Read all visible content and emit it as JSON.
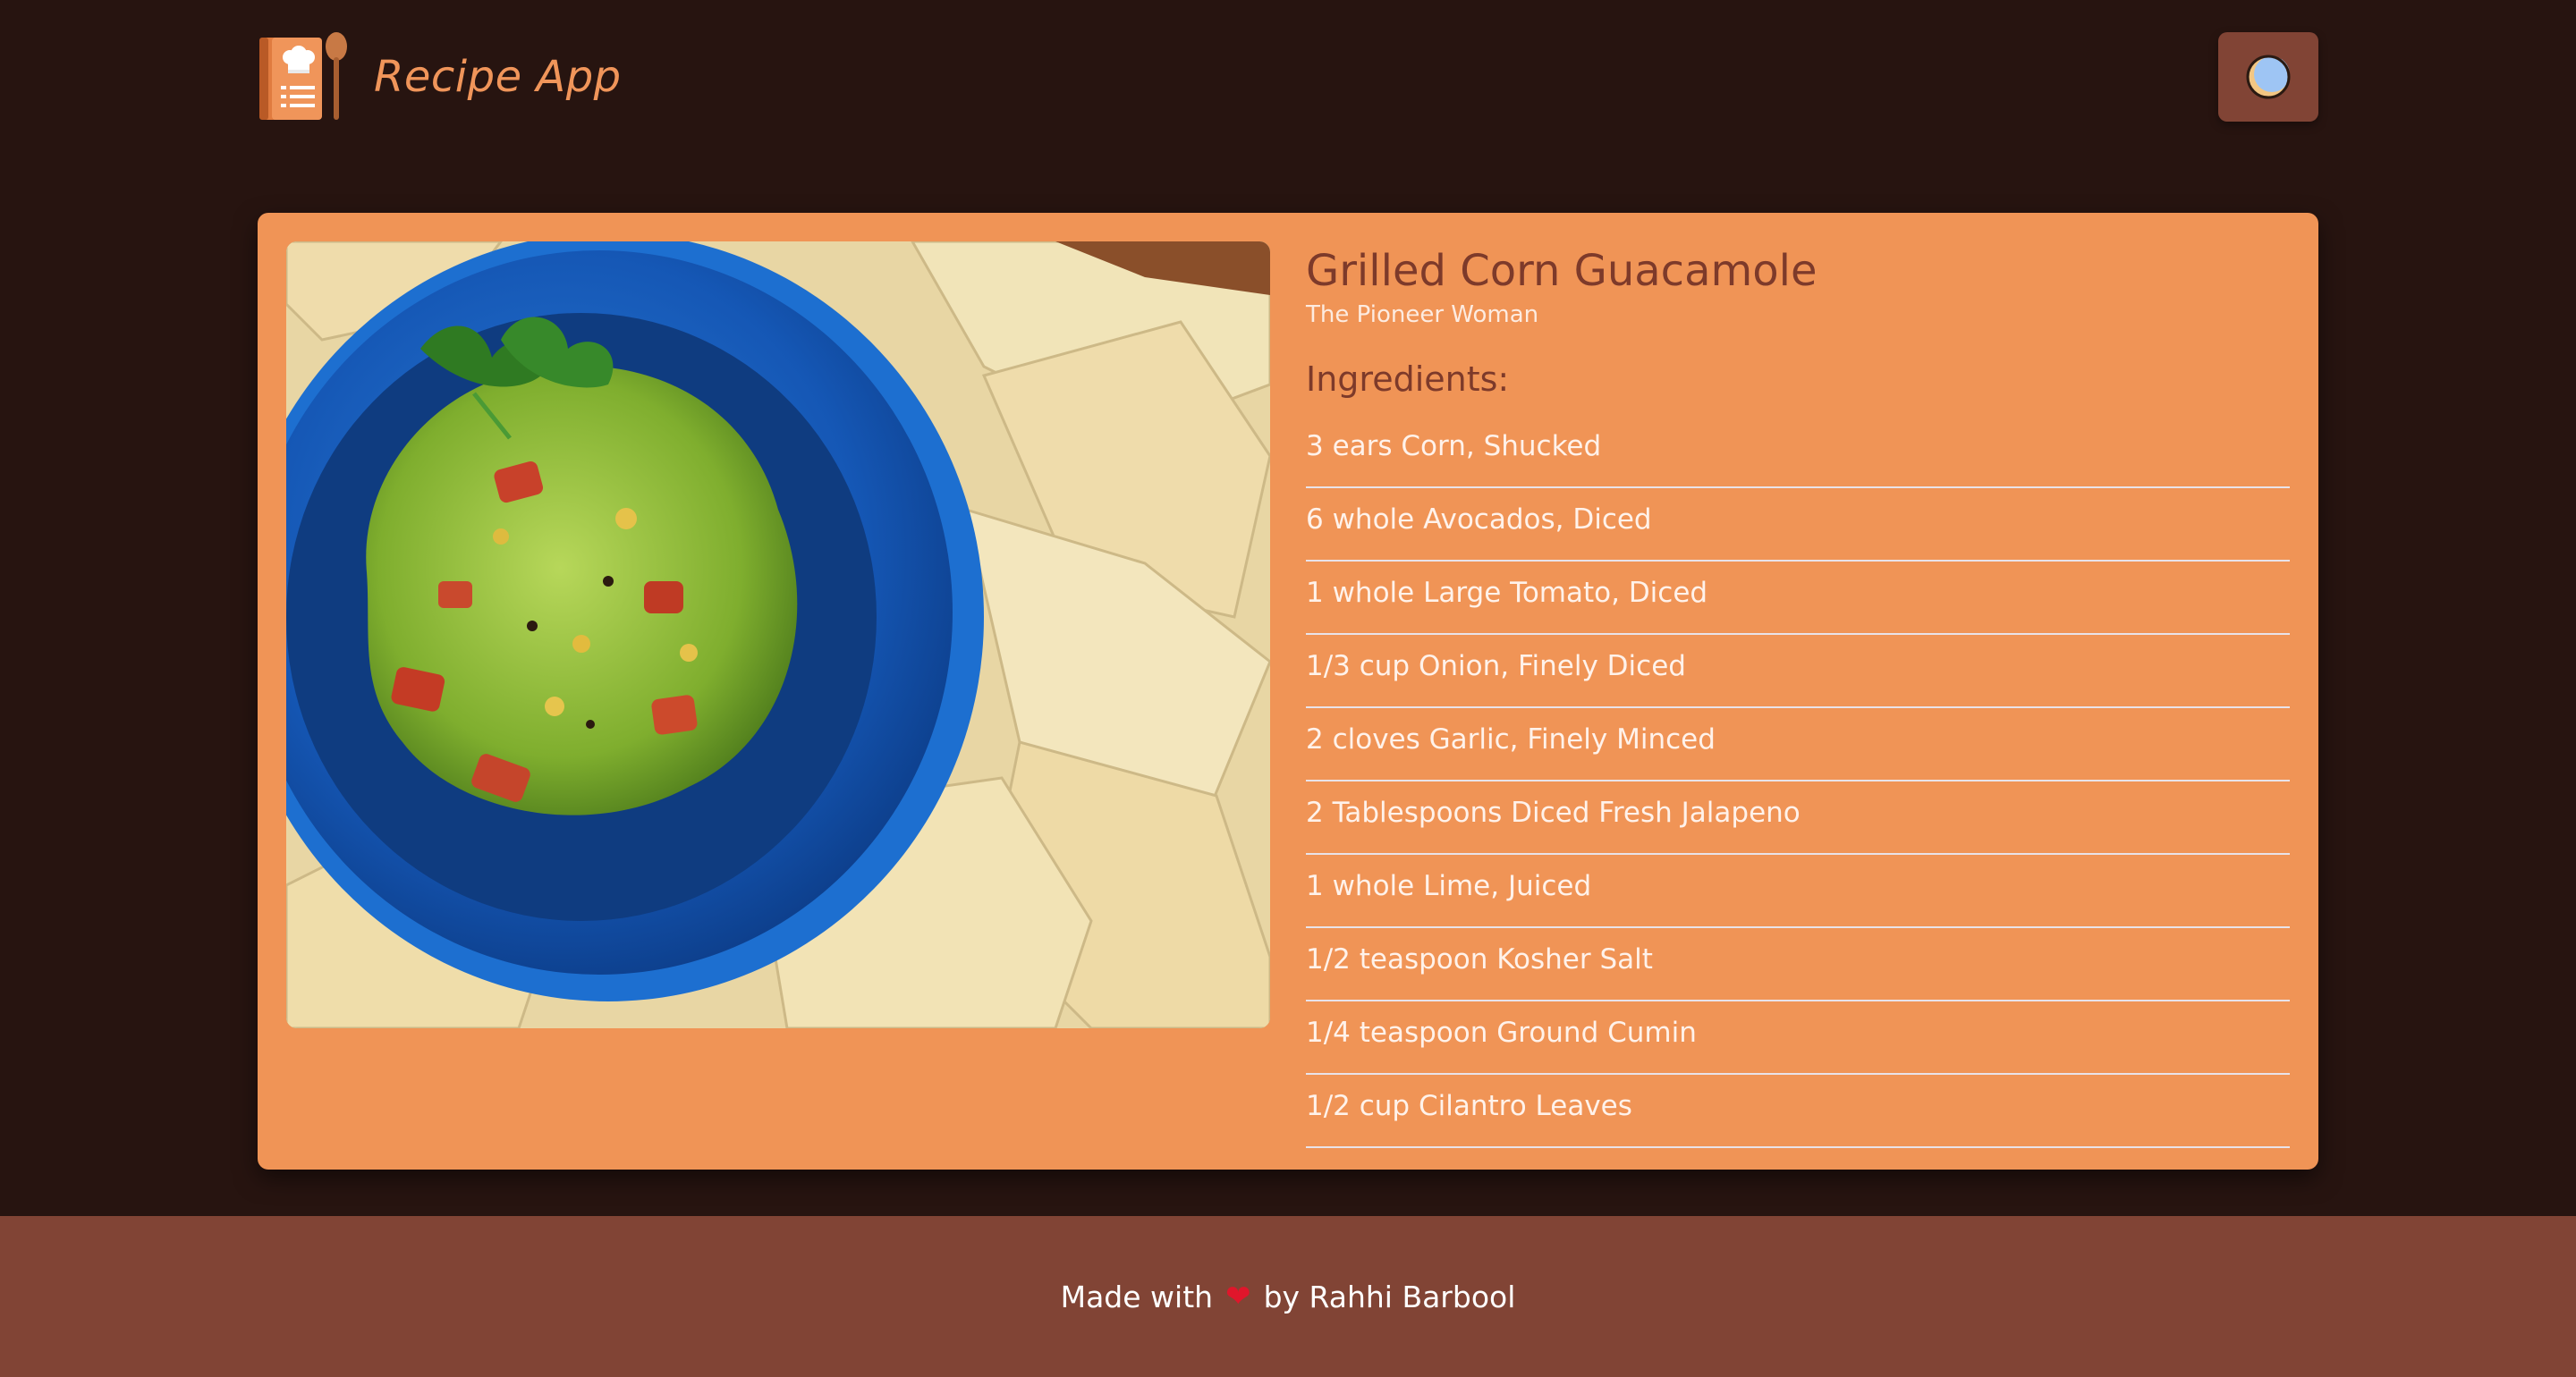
{
  "app": {
    "title": "Recipe App",
    "logo_icon": "cookbook-spoon-icon"
  },
  "header": {
    "theme_toggle_icon": "moon-icon"
  },
  "recipe": {
    "title": "Grilled Corn Guacamole",
    "source": "The Pioneer Woman",
    "ingredients_heading": "Ingredients:",
    "ingredients": [
      "3 ears Corn, Shucked",
      "6 whole Avocados, Diced",
      "1 whole Large Tomato, Diced",
      "1/3 cup Onion, Finely Diced",
      "2 cloves Garlic, Finely Minced",
      "2 Tablespoons Diced Fresh Jalapeno",
      "1 whole Lime, Juiced",
      "1/2 teaspoon Kosher Salt",
      "1/4 teaspoon Ground Cumin",
      "1/2 cup Cilantro Leaves"
    ]
  },
  "footer": {
    "prefix": "Made with",
    "heart": "❤",
    "suffix": "by Rahhi Barbool"
  },
  "colors": {
    "background": "#271410",
    "accent": "#f09456",
    "footer": "#814435",
    "title_text": "#7d3a2a"
  }
}
